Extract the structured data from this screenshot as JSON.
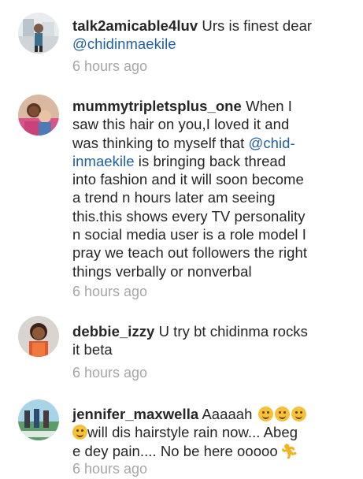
{
  "comments": [
    {
      "username": "talk2amicable4luv",
      "text_before": " Urs is finest dear",
      "mention": "@chidinmaekile",
      "time": "6 hours ago"
    },
    {
      "username": "mummytripletsplus_one",
      "line1_rest": " When I",
      "line2": "saw this hair on you,I loved it and",
      "line3_before": "was thinking to myself that ",
      "mention_part1": "@chid-",
      "mention_part2": "inmaekile",
      "line4_rest": " is bringing back thread",
      "line5": "into fashion and it will soon become",
      "line6": "a trend n hours later am seeing",
      "line7": "this.this shows every TV personality",
      "line8": "n social media user is a role model I",
      "line9": "pray we teach out followers the right",
      "line10": "things verbally or nonverbal",
      "time": "6 hours ago"
    },
    {
      "username": "debbie_izzy",
      "line1_rest": " U try bt chidinma rocks",
      "line2": "it beta",
      "time": "6 hours ago"
    },
    {
      "username": "jennifer_maxwella",
      "line1_rest": " Aaaaah",
      "line2_rest": "will dis hairstyle rain now... Abeg",
      "line3": "e dey pain.... No be here ooooo",
      "time": "6 hours ago"
    }
  ]
}
